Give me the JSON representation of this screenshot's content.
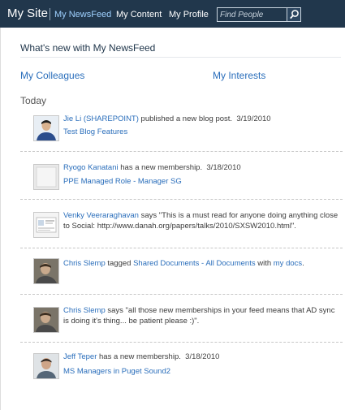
{
  "nav": {
    "site_title": "My Site",
    "links": [
      "My NewsFeed",
      "My Content",
      "My Profile"
    ],
    "search_placeholder": "Find People"
  },
  "header": {
    "title": "What's new with My NewsFeed",
    "colleagues_link": "My Colleagues",
    "interests_link": "My Interests"
  },
  "section": {
    "label": "Today"
  },
  "feed": [
    {
      "actor": "Jie Li (SHAREPOINT)",
      "action": " published a new blog post.",
      "date": "3/19/2010",
      "link": "Test Blog Features"
    },
    {
      "actor": "Ryogo Kanatani",
      "action": " has a new membership.",
      "date": "3/18/2010",
      "link": "PPE Managed Role - Manager SG"
    },
    {
      "actor": "Venky Veeraraghavan",
      "action": " says \"This is a must read for anyone doing anything close to Social: http://www.danah.org/papers/talks/2010/SXSW2010.html\"."
    },
    {
      "actor": "Chris Slemp",
      "action_1": " tagged ",
      "target": "Shared Documents - All Documents",
      "action_2": " with ",
      "tag": "my docs",
      "end": "."
    },
    {
      "actor": "Chris Slemp",
      "action": " says \"all those new memberships in your feed means that AD sync is doing it's thing... be patient please :)\"."
    },
    {
      "actor": "Jeff Teper",
      "action": " has a new membership.",
      "date": "3/18/2010",
      "link": "MS Managers in Puget Sound2"
    }
  ]
}
